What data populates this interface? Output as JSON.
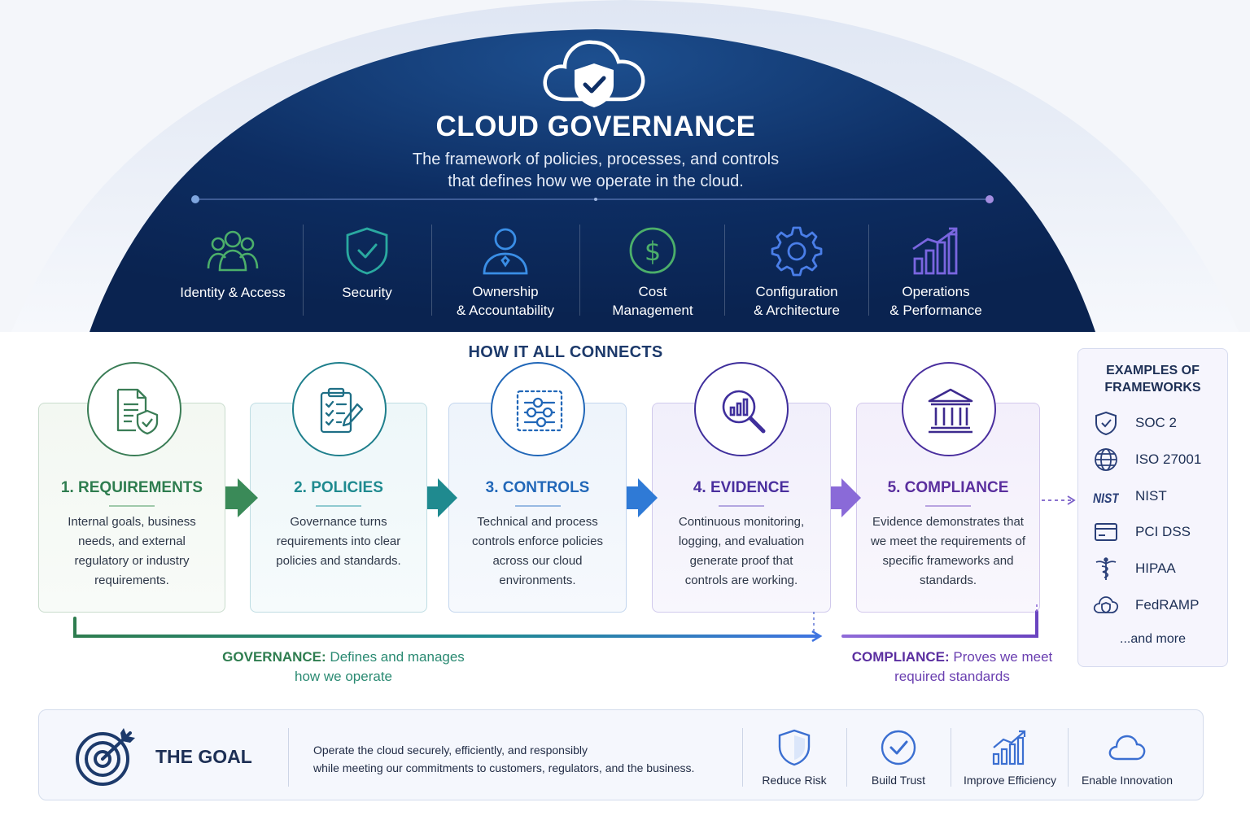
{
  "hero": {
    "title": "CLOUD GOVERNANCE",
    "subtitle_line1": "The framework of policies, processes, and controls",
    "subtitle_line2": "that defines how we operate in the cloud."
  },
  "categories": [
    {
      "line1": "Identity & Access",
      "line2": "",
      "icon": "people-icon",
      "color": "#4caf6a"
    },
    {
      "line1": "Security",
      "line2": "",
      "icon": "shield-check-icon",
      "color": "#2aa9a0"
    },
    {
      "line1": "Ownership",
      "line2": "& Accountability",
      "icon": "user-owner-icon",
      "color": "#3a8ee6"
    },
    {
      "line1": "Cost",
      "line2": "Management",
      "icon": "dollar-icon",
      "color": "#4caf6a"
    },
    {
      "line1": "Configuration",
      "line2": "& Architecture",
      "icon": "gear-icon",
      "color": "#4a7ee8"
    },
    {
      "line1": "Operations",
      "line2": "& Performance",
      "icon": "bar-chart-icon",
      "color": "#7a66e0"
    }
  ],
  "flow": {
    "title": "HOW IT ALL CONNECTS",
    "steps": [
      {
        "title": "1. REQUIREMENTS",
        "desc": "Internal goals, business needs, and external regulatory or industry requirements.",
        "color": "#2e7d4f",
        "icon": "document-shield-icon"
      },
      {
        "title": "2. POLICIES",
        "desc": "Governance turns requirements into clear policies and standards.",
        "color": "#1f8a8f",
        "icon": "clipboard-checklist-icon"
      },
      {
        "title": "3. CONTROLS",
        "desc": "Technical and process controls enforce policies across our cloud environments.",
        "color": "#2167b8",
        "icon": "sliders-icon"
      },
      {
        "title": "4. EVIDENCE",
        "desc": "Continuous monitoring, logging, and evaluation generate proof that controls are working.",
        "color": "#4a2f9e",
        "icon": "magnifier-chart-icon"
      },
      {
        "title": "5. COMPLIANCE",
        "desc": "Evidence demonstrates that we meet the requirements of specific frameworks and standards.",
        "color": "#5a2f9e",
        "icon": "institution-icon"
      }
    ],
    "governance_label": "GOVERNANCE:",
    "governance_text1": "Defines and manages",
    "governance_text2": "how we operate",
    "compliance_label": "COMPLIANCE:",
    "compliance_text1": "Proves we meet",
    "compliance_text2": "required standards"
  },
  "frameworks": {
    "title_line1": "EXAMPLES OF",
    "title_line2": "FRAMEWORKS",
    "items": [
      {
        "name": "SOC 2",
        "icon": "shield-check-icon"
      },
      {
        "name": "ISO 27001",
        "icon": "globe-icon"
      },
      {
        "name": "NIST",
        "icon": "nist-logo-icon",
        "logo_text": "NIST"
      },
      {
        "name": "PCI DSS",
        "icon": "credit-card-icon"
      },
      {
        "name": "HIPAA",
        "icon": "caduceus-icon"
      },
      {
        "name": "FedRAMP",
        "icon": "cloud-shield-icon"
      }
    ],
    "more": "...and more"
  },
  "goal": {
    "title": "THE GOAL",
    "desc_line1": "Operate the cloud securely, efficiently, and responsibly",
    "desc_line2": "while meeting our commitments to customers, regulators, and the business.",
    "benefits": [
      {
        "label": "Reduce Risk",
        "icon": "shield-icon"
      },
      {
        "label": "Build Trust",
        "icon": "check-circle-icon"
      },
      {
        "label": "Improve Efficiency",
        "icon": "growth-chart-icon"
      },
      {
        "label": "Enable Innovation",
        "icon": "cloud-icon"
      }
    ]
  },
  "colors": {
    "navy": "#0c2a5a",
    "green": "#2e7d4f",
    "teal": "#1f8a8f",
    "blue": "#2167b8",
    "purple": "#5a2f9e"
  }
}
